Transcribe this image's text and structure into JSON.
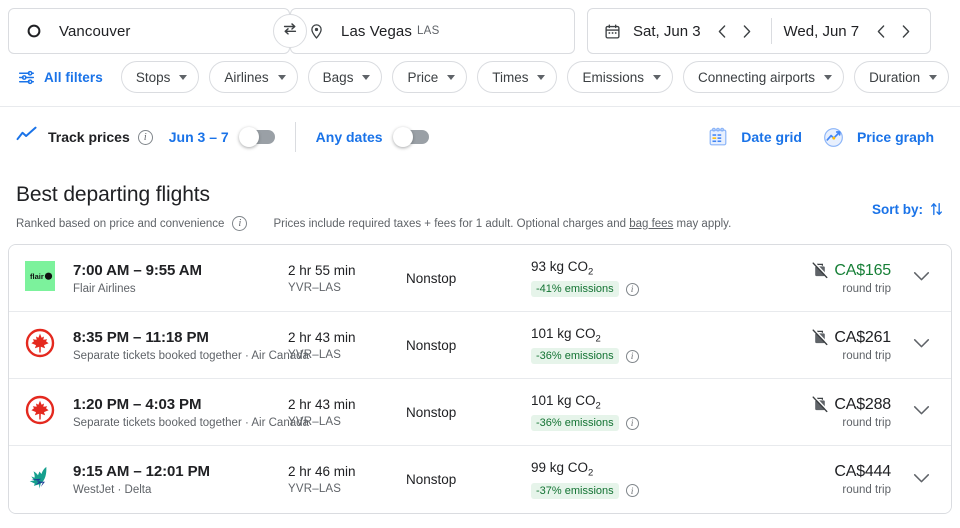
{
  "search": {
    "origin": {
      "label": "Vancouver",
      "code": "",
      "icon": "circle-origin-icon"
    },
    "destination": {
      "label": "Las Vegas",
      "code": "LAS",
      "icon": "location-pin-icon"
    },
    "swap_icon": "swap-arrows-icon",
    "calendar_icon": "calendar-icon",
    "depart_date": "Sat, Jun 3",
    "return_date": "Wed, Jun 7",
    "prev_icon": "chevron-left-icon",
    "next_icon": "chevron-right-icon"
  },
  "filters": {
    "all_filters_label": "All filters",
    "all_filters_icon": "filter-sliders-icon",
    "chips": [
      {
        "label": "Stops"
      },
      {
        "label": "Airlines"
      },
      {
        "label": "Bags"
      },
      {
        "label": "Price"
      },
      {
        "label": "Times"
      },
      {
        "label": "Emissions"
      },
      {
        "label": "Connecting airports"
      },
      {
        "label": "Duration"
      }
    ]
  },
  "track": {
    "icon": "price-trend-line-icon",
    "label": "Track prices",
    "info_icon": "info-icon",
    "date_range_label": "Jun 3 – 7",
    "date_range_toggle_on": false,
    "any_dates_label": "Any dates",
    "any_dates_toggle_on": false,
    "date_grid_label": "Date grid",
    "date_grid_icon": "calendar-grid-icon",
    "price_graph_label": "Price graph",
    "price_graph_icon": "price-graph-icon"
  },
  "section": {
    "title": "Best departing flights",
    "ranked_note": "Ranked based on price and convenience",
    "ranked_info_icon": "info-icon",
    "prices_note_pre": "Prices include required taxes + fees for 1 adult. Optional charges and ",
    "prices_note_link": "bag fees",
    "prices_note_post": " may apply.",
    "sort_by_label": "Sort by:",
    "sort_by_icon": "sort-arrows-icon"
  },
  "colors": {
    "accent_blue": "#1a73e8",
    "price_green": "#188038",
    "badge_bg": "#e6f4ea",
    "badge_text": "#137333",
    "flair_green": "#7cf29c",
    "air_canada_red": "#e4291f",
    "westjet_teal": "#16a08e",
    "westjet_navy": "#1c3f94"
  },
  "flights": [
    {
      "logo": "flair-airlines-logo",
      "times": "7:00 AM – 9:55 AM",
      "airline": "Flair Airlines",
      "duration": "2 hr 55 min",
      "route": "YVR–LAS",
      "stops": "Nonstop",
      "co2_value": "93 kg CO",
      "co2_sub": "2",
      "emissions_badge": "-41% emissions",
      "emissions_info_icon": "info-icon",
      "no_bag_icon": "no-carryon-bag-icon",
      "has_no_bag_icon": true,
      "price": "CA$165",
      "price_is_green": true,
      "trip_type": "round trip",
      "expand_icon": "chevron-down-icon"
    },
    {
      "logo": "air-canada-logo",
      "times": "8:35 PM – 11:18 PM",
      "airline": "Separate tickets booked together · Air Canada",
      "duration": "2 hr 43 min",
      "route": "YVR–LAS",
      "stops": "Nonstop",
      "co2_value": "101 kg CO",
      "co2_sub": "2",
      "emissions_badge": "-36% emissions",
      "emissions_info_icon": "info-icon",
      "no_bag_icon": "no-carryon-bag-icon",
      "has_no_bag_icon": true,
      "price": "CA$261",
      "price_is_green": false,
      "trip_type": "round trip",
      "expand_icon": "chevron-down-icon"
    },
    {
      "logo": "air-canada-logo",
      "times": "1:20 PM – 4:03 PM",
      "airline": "Separate tickets booked together · Air Canada",
      "duration": "2 hr 43 min",
      "route": "YVR–LAS",
      "stops": "Nonstop",
      "co2_value": "101 kg CO",
      "co2_sub": "2",
      "emissions_badge": "-36% emissions",
      "emissions_info_icon": "info-icon",
      "no_bag_icon": "no-carryon-bag-icon",
      "has_no_bag_icon": true,
      "price": "CA$288",
      "price_is_green": false,
      "trip_type": "round trip",
      "expand_icon": "chevron-down-icon"
    },
    {
      "logo": "westjet-logo",
      "times": "9:15 AM – 12:01 PM",
      "airline": "WestJet · Delta",
      "duration": "2 hr 46 min",
      "route": "YVR–LAS",
      "stops": "Nonstop",
      "co2_value": "99 kg CO",
      "co2_sub": "2",
      "emissions_badge": "-37% emissions",
      "emissions_info_icon": "info-icon",
      "no_bag_icon": "",
      "has_no_bag_icon": false,
      "price": "CA$444",
      "price_is_green": false,
      "trip_type": "round trip",
      "expand_icon": "chevron-down-icon"
    }
  ]
}
